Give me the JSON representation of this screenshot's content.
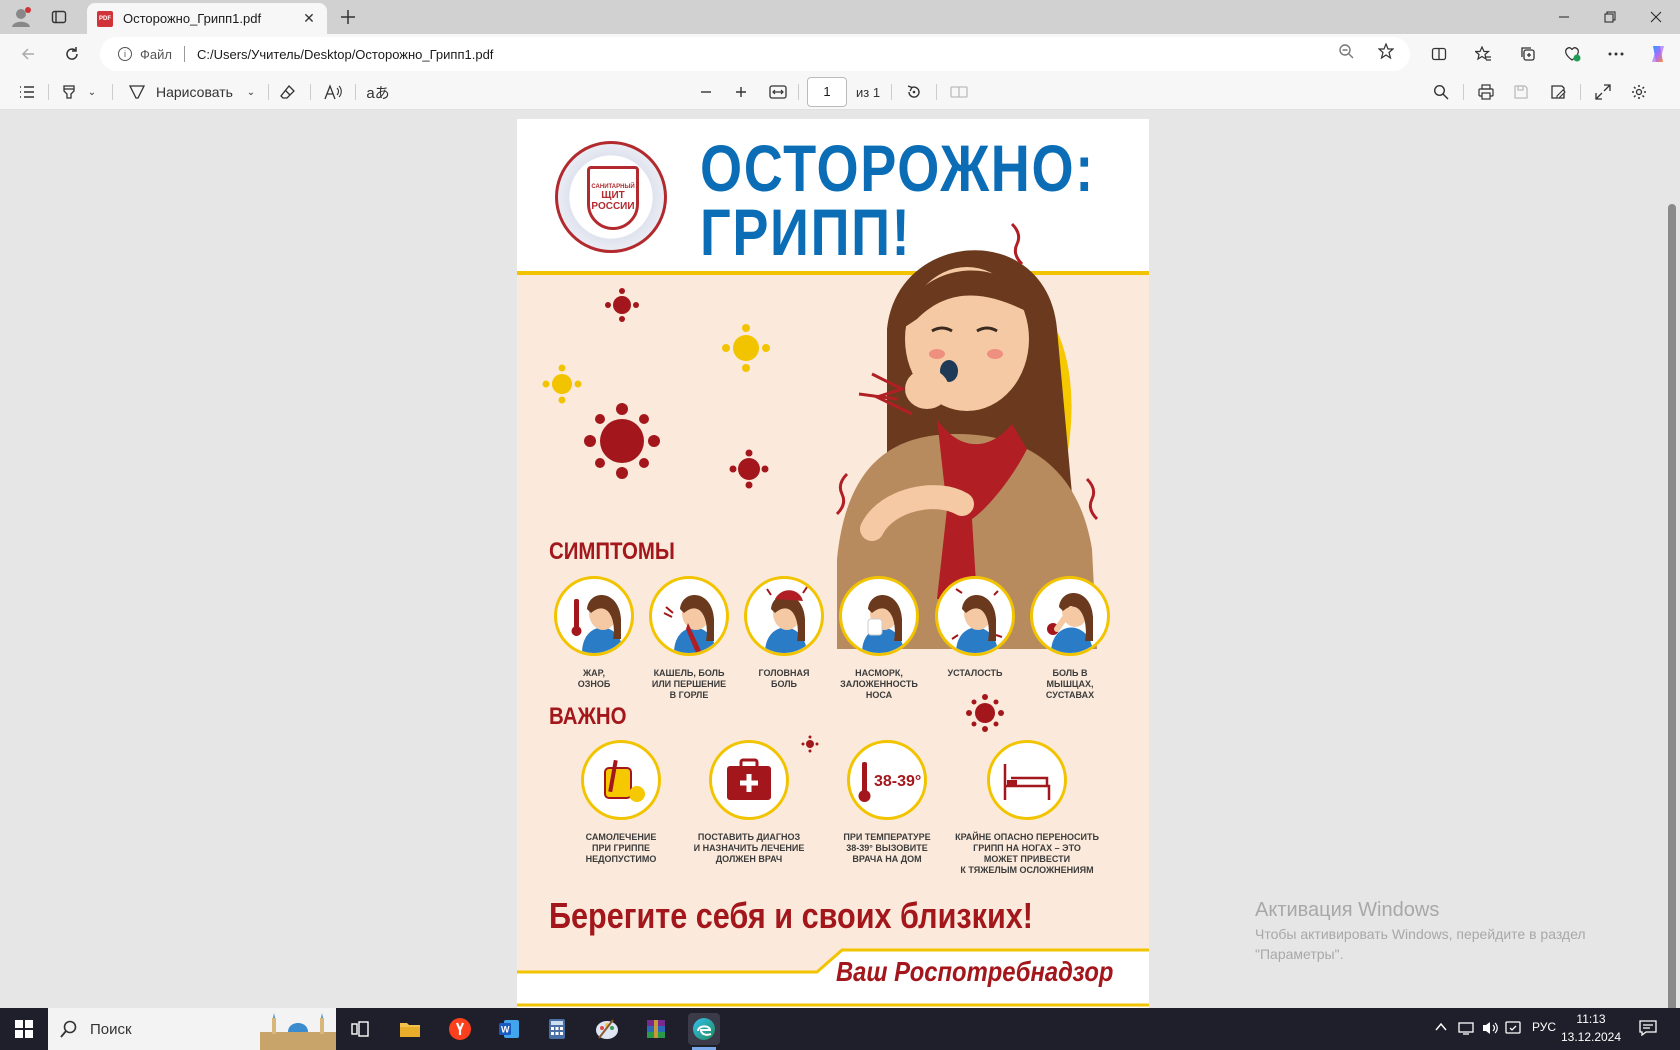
{
  "browser": {
    "tab_title": "Осторожно_Грипп1.pdf",
    "file_label": "Файл",
    "url": "C:/Users/Учитель/Desktop/Осторожно_Грипп1.pdf"
  },
  "pdf_toolbar": {
    "draw_label": "Нарисовать",
    "page_current": "1",
    "page_total": "из 1"
  },
  "poster": {
    "logo_line1": "САНИТАРНЫЙ",
    "logo_line2": "ЩИТ",
    "logo_line3": "РОССИИ",
    "title_line1": "ОСТОРОЖНО:",
    "title_line2": "ГРИПП!",
    "symptoms_heading": "СИМПТОМЫ",
    "symptoms": [
      {
        "caption": "ЖАР,\nОЗНОБ"
      },
      {
        "caption": "КАШЕЛЬ, БОЛЬ\nИЛИ ПЕРШЕНИЕ\nВ ГОРЛЕ"
      },
      {
        "caption": "ГОЛОВНАЯ\nБОЛЬ"
      },
      {
        "caption": "НАСМОРК,\nЗАЛОЖЕННОСТЬ\nНОСА"
      },
      {
        "caption": "УСТАЛОСТЬ"
      },
      {
        "caption": "БОЛЬ В МЫШЦАХ,\nСУСТАВАХ"
      }
    ],
    "important_heading": "ВАЖНО",
    "important": [
      {
        "caption": "САМОЛЕЧЕНИЕ\nПРИ ГРИППЕ\nНЕДОПУСТИМО"
      },
      {
        "caption": "ПОСТАВИТЬ ДИАГНОЗ\nИ НАЗНАЧИТЬ ЛЕЧЕНИЕ\nДОЛЖЕН ВРАЧ"
      },
      {
        "caption": "ПРИ ТЕМПЕРАТУРЕ\n38-39° ВЫЗОВИТЕ\nВРАЧА НА ДОМ"
      },
      {
        "caption": "КРАЙНЕ ОПАСНО ПЕРЕНОСИТЬ\nГРИПП НА НОГАХ – ЭТО\nМОЖЕТ ПРИВЕСТИ\nК ТЯЖЕЛЫМ ОСЛОЖНЕНИЯМ"
      }
    ],
    "temp_badge": "38-39°",
    "slogan": "Берегите себя и своих близких!",
    "signature": "Ваш Роспотребнадзор"
  },
  "watermark": {
    "title": "Активация Windows",
    "text": "Чтобы активировать Windows, перейдите в раздел \"Параметры\"."
  },
  "taskbar": {
    "search_label": "Поиск",
    "lang": "РУС",
    "time": "11:13",
    "date": "13.12.2024"
  },
  "colors": {
    "title_blue": "#0a6db6",
    "accent_red": "#a3171c",
    "accent_yellow": "#f2c400",
    "poster_bg": "#fbeadb"
  }
}
